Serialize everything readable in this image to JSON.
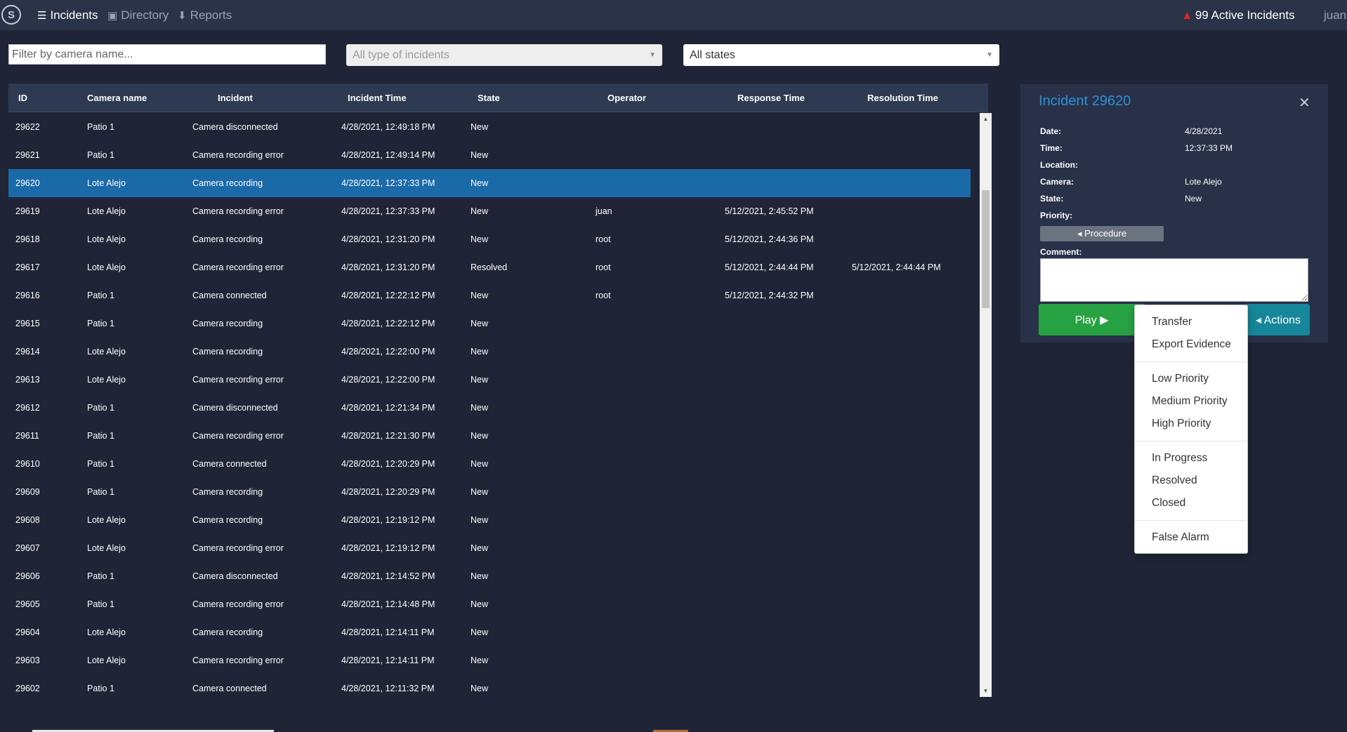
{
  "navbar": {
    "logo": "S",
    "items": [
      {
        "label": "Incidents",
        "icon": "list-icon",
        "glyph": "☰"
      },
      {
        "label": "Directory",
        "icon": "address-book-icon",
        "glyph": "▣"
      },
      {
        "label": "Reports",
        "icon": "download-icon",
        "glyph": "⬇"
      }
    ],
    "alert_text": "99 Active Incidents",
    "user": "juan"
  },
  "filters": {
    "camera_placeholder": "Filter by camera name...",
    "type_select": "All type of incidents",
    "state_select": "All states"
  },
  "table": {
    "headers": [
      "ID",
      "Camera name",
      "Incident",
      "Incident Time",
      "State",
      "Operator",
      "Response Time",
      "Resolution Time"
    ],
    "rows": [
      [
        "29622",
        "Patio 1",
        "Camera disconnected",
        "4/28/2021, 12:49:18 PM",
        "New",
        "",
        "",
        ""
      ],
      [
        "29621",
        "Patio 1",
        "Camera recording error",
        "4/28/2021, 12:49:14 PM",
        "New",
        "",
        "",
        ""
      ],
      [
        "29620",
        "Lote Alejo",
        "Camera recording",
        "4/28/2021, 12:37:33 PM",
        "New",
        "",
        "",
        ""
      ],
      [
        "29619",
        "Lote Alejo",
        "Camera recording error",
        "4/28/2021, 12:37:33 PM",
        "New",
        "juan",
        "5/12/2021, 2:45:52 PM",
        ""
      ],
      [
        "29618",
        "Lote Alejo",
        "Camera recording",
        "4/28/2021, 12:31:20 PM",
        "New",
        "root",
        "5/12/2021, 2:44:36 PM",
        ""
      ],
      [
        "29617",
        "Lote Alejo",
        "Camera recording error",
        "4/28/2021, 12:31:20 PM",
        "Resolved",
        "root",
        "5/12/2021, 2:44:44 PM",
        "5/12/2021, 2:44:44 PM"
      ],
      [
        "29616",
        "Patio 1",
        "Camera connected",
        "4/28/2021, 12:22:12 PM",
        "New",
        "root",
        "5/12/2021, 2:44:32 PM",
        ""
      ],
      [
        "29615",
        "Patio 1",
        "Camera recording",
        "4/28/2021, 12:22:12 PM",
        "New",
        "",
        "",
        ""
      ],
      [
        "29614",
        "Lote Alejo",
        "Camera recording",
        "4/28/2021, 12:22:00 PM",
        "New",
        "",
        "",
        ""
      ],
      [
        "29613",
        "Lote Alejo",
        "Camera recording error",
        "4/28/2021, 12:22:00 PM",
        "New",
        "",
        "",
        ""
      ],
      [
        "29612",
        "Patio 1",
        "Camera disconnected",
        "4/28/2021, 12:21:34 PM",
        "New",
        "",
        "",
        ""
      ],
      [
        "29611",
        "Patio 1",
        "Camera recording error",
        "4/28/2021, 12:21:30 PM",
        "New",
        "",
        "",
        ""
      ],
      [
        "29610",
        "Patio 1",
        "Camera connected",
        "4/28/2021, 12:20:29 PM",
        "New",
        "",
        "",
        ""
      ],
      [
        "29609",
        "Patio 1",
        "Camera recording",
        "4/28/2021, 12:20:29 PM",
        "New",
        "",
        "",
        ""
      ],
      [
        "29608",
        "Lote Alejo",
        "Camera recording",
        "4/28/2021, 12:19:12 PM",
        "New",
        "",
        "",
        ""
      ],
      [
        "29607",
        "Lote Alejo",
        "Camera recording error",
        "4/28/2021, 12:19:12 PM",
        "New",
        "",
        "",
        ""
      ],
      [
        "29606",
        "Patio 1",
        "Camera disconnected",
        "4/28/2021, 12:14:52 PM",
        "New",
        "",
        "",
        ""
      ],
      [
        "29605",
        "Patio 1",
        "Camera recording error",
        "4/28/2021, 12:14:48 PM",
        "New",
        "",
        "",
        ""
      ],
      [
        "29604",
        "Lote Alejo",
        "Camera recording",
        "4/28/2021, 12:14:11 PM",
        "New",
        "",
        "",
        ""
      ],
      [
        "29603",
        "Lote Alejo",
        "Camera recording error",
        "4/28/2021, 12:14:11 PM",
        "New",
        "",
        "",
        ""
      ],
      [
        "29602",
        "Patio 1",
        "Camera connected",
        "4/28/2021, 12:11:32 PM",
        "New",
        "",
        "",
        ""
      ]
    ],
    "selected_id": "29620"
  },
  "detail": {
    "title": "Incident 29620",
    "close_glyph": "✕",
    "fields": [
      {
        "label": "Date:",
        "value": "4/28/2021"
      },
      {
        "label": "Time:",
        "value": "12:37:33 PM"
      },
      {
        "label": "Location:",
        "value": ""
      },
      {
        "label": "Camera:",
        "value": "Lote Alejo"
      },
      {
        "label": "State:",
        "value": "New"
      },
      {
        "label": "Priority:",
        "value": ""
      }
    ],
    "procedure_label": "◂ Procedure",
    "comment_label": "Comment:",
    "play_label": "Play ▶",
    "actions_label": "◂ Actions"
  },
  "actions_menu": {
    "groups": [
      [
        "Transfer",
        "Export Evidence"
      ],
      [
        "Low Priority",
        "Medium Priority",
        "High Priority"
      ],
      [
        "In Progress",
        "Resolved",
        "Closed"
      ],
      [
        "False Alarm"
      ]
    ]
  },
  "colors": {
    "background": "#1f2536",
    "navbar": "#2a3348",
    "selected_row": "#1a6aa8",
    "accent_title": "#2f8fd8",
    "play": "#27a243",
    "actions": "#16869a",
    "alert": "#e02424"
  }
}
